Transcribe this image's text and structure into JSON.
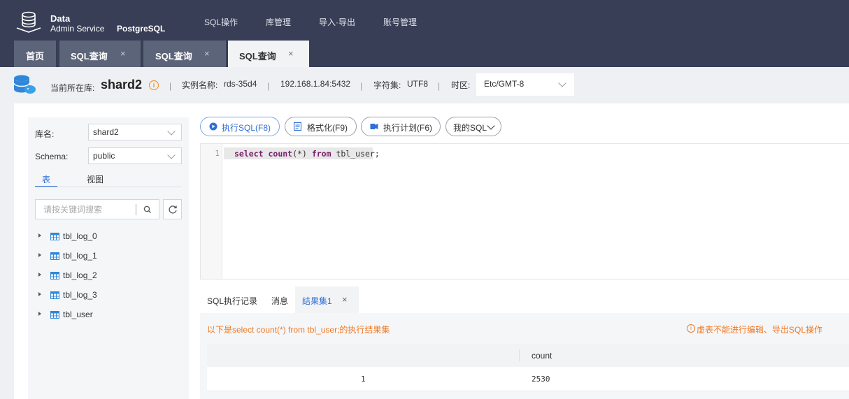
{
  "app": {
    "brand_line1": "Data",
    "brand_line2": "Admin Service",
    "product": "PostgreSQL"
  },
  "nav": [
    {
      "label": "SQL操作"
    },
    {
      "label": "库管理"
    },
    {
      "label": "导入·导出"
    },
    {
      "label": "账号管理"
    }
  ],
  "tabs": [
    {
      "label": "首页",
      "closable": false,
      "active": false
    },
    {
      "label": "SQL查询",
      "closable": true,
      "active": false
    },
    {
      "label": "SQL查询",
      "closable": true,
      "active": false
    },
    {
      "label": "SQL查询",
      "closable": true,
      "active": true
    }
  ],
  "close_glyph": "×",
  "info": {
    "current_db_label": "当前所在库:",
    "current_db": "shard2",
    "instance_label": "实例名称:",
    "instance": "rds-35d4",
    "address": "192.168.1.84:5432",
    "charset_label": "字符集:",
    "charset": "UTF8",
    "timezone_label": "时区:",
    "timezone": "Etc/GMT-8",
    "separator": "|"
  },
  "sidebar": {
    "db_label": "库名:",
    "db_value": "shard2",
    "schema_label": "Schema:",
    "schema_value": "public",
    "tabs": [
      {
        "label": "表",
        "active": true
      },
      {
        "label": "视图",
        "active": false
      }
    ],
    "search_placeholder": "请按关键词搜索",
    "tables": [
      {
        "name": "tbl_log_0"
      },
      {
        "name": "tbl_log_1"
      },
      {
        "name": "tbl_log_2"
      },
      {
        "name": "tbl_log_3"
      },
      {
        "name": "tbl_user"
      }
    ]
  },
  "toolbar": {
    "run_label": "执行SQL(F8)",
    "format_label": "格式化(F9)",
    "plan_label": "执行计划(F6)",
    "my_sql_label": "我的SQL"
  },
  "editor": {
    "line_number": "1",
    "kw_select": "select",
    "kw_count": "count",
    "paren": "(*)",
    "kw_from": "from",
    "rest": "tbl_user;"
  },
  "results": {
    "tabs": [
      {
        "label": "SQL执行记录",
        "active": false
      },
      {
        "label": "消息",
        "active": false
      },
      {
        "label": "结果集1",
        "active": true
      }
    ],
    "message": "以下是select count(*) from tbl_user;的执行结果集",
    "warning": "虚表不能进行编辑、导出SQL操作",
    "columns": [
      "count"
    ],
    "rows": [
      {
        "index": "1",
        "count": "2530"
      }
    ]
  },
  "colors": {
    "header_bg": "#383e56",
    "accent": "#2f6fd6",
    "warning": "#f07a24"
  }
}
